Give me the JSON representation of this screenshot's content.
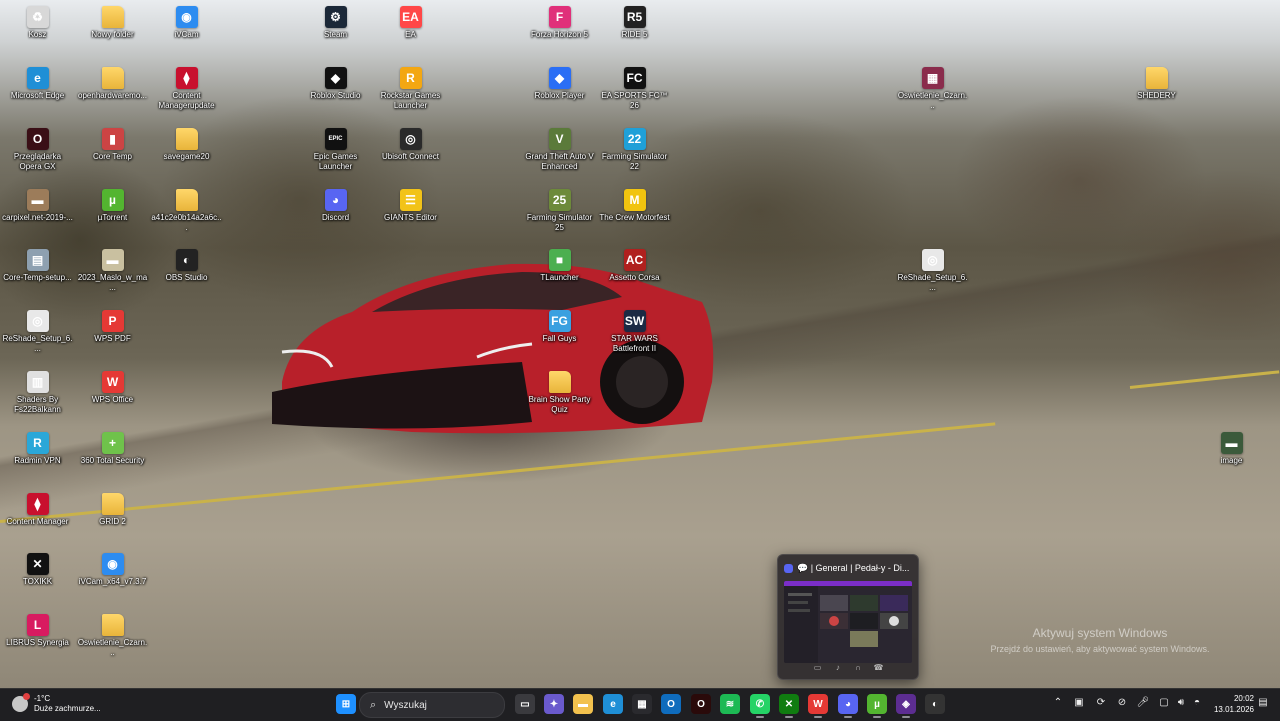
{
  "desktop": {
    "icons": [
      {
        "label": "Kosz",
        "icon": "recycle-bin-icon",
        "color": "#d8d8d8",
        "glyph": "♻"
      },
      {
        "label": "Nowy folder",
        "icon": "folder-icon",
        "color": "folder",
        "glyph": ""
      },
      {
        "label": "iVCam",
        "icon": "ivcam-icon",
        "color": "#2d8cf0",
        "glyph": "◉"
      },
      {
        "label": "Steam",
        "icon": "steam-icon",
        "color": "#1b2838",
        "glyph": "⚙"
      },
      {
        "label": "EA",
        "icon": "ea-icon",
        "color": "#ff4747",
        "glyph": "EA"
      },
      {
        "label": "Forza Horizon 5",
        "icon": "forza-icon",
        "color": "#e0307a",
        "glyph": "F"
      },
      {
        "label": "RIDE 5",
        "icon": "ride5-icon",
        "color": "#222222",
        "glyph": "R5"
      },
      {
        "label": "Microsoft Edge",
        "icon": "edge-icon",
        "color": "#1f8fd6",
        "glyph": "e"
      },
      {
        "label": "openhardwaremo...",
        "icon": "folder-icon",
        "color": "folder",
        "glyph": ""
      },
      {
        "label": "Content Managerupdate",
        "icon": "content-manager-icon",
        "color": "#c8102e",
        "glyph": "⧫"
      },
      {
        "label": "Roblox Studio",
        "icon": "roblox-studio-icon",
        "color": "#111111",
        "glyph": "◆"
      },
      {
        "label": "Rockstar Games Launcher",
        "icon": "rockstar-icon",
        "color": "#f3a712",
        "glyph": "R"
      },
      {
        "label": "Roblox Player",
        "icon": "roblox-player-icon",
        "color": "#2a6ef5",
        "glyph": "◆"
      },
      {
        "label": "EA SPORTS FC™ 26",
        "icon": "ea-fc-icon",
        "color": "#111111",
        "glyph": "FC"
      },
      {
        "label": "Oswietlenie_Czarn...",
        "icon": "winrar-icon",
        "color": "#8a2c4c",
        "glyph": "▦"
      },
      {
        "label": "SHEDERY",
        "icon": "folder-icon",
        "color": "folder",
        "glyph": ""
      },
      {
        "label": "Przeglądarka Opera GX",
        "icon": "opera-gx-icon",
        "color": "#3a0f16",
        "glyph": "O"
      },
      {
        "label": "Core Temp",
        "icon": "core-temp-icon",
        "color": "#c44",
        "glyph": "▮"
      },
      {
        "label": "savegame20",
        "icon": "folder-icon",
        "color": "folder",
        "glyph": ""
      },
      {
        "label": "Epic Games Launcher",
        "icon": "epic-games-icon",
        "color": "#111111",
        "glyph": "EPIC"
      },
      {
        "label": "Ubisoft Connect",
        "icon": "ubisoft-icon",
        "color": "#2a2a2a",
        "glyph": "◎"
      },
      {
        "label": "Grand Theft Auto V Enhanced",
        "icon": "gta5-icon",
        "color": "#5b7a3a",
        "glyph": "V"
      },
      {
        "label": "Farming Simulator 22",
        "icon": "farming-sim-22-icon",
        "color": "#1fa0d8",
        "glyph": "22"
      },
      {
        "label": "carpixel.net-2019-...",
        "icon": "image-file-icon",
        "color": "#9c7c5a",
        "glyph": "▬"
      },
      {
        "label": "µTorrent",
        "icon": "utorrent-icon",
        "color": "#53b530",
        "glyph": "µ"
      },
      {
        "label": "a41c2e0b14a2a6c...",
        "icon": "folder-icon",
        "color": "folder",
        "glyph": ""
      },
      {
        "label": "Discord",
        "icon": "discord-icon",
        "color": "#5865f2",
        "glyph": "◕"
      },
      {
        "label": "GIANTS Editor",
        "icon": "giants-editor-icon",
        "color": "#f2c318",
        "glyph": "☰"
      },
      {
        "label": "Farming Simulator 25",
        "icon": "farming-sim-25-icon",
        "color": "#6d8a3a",
        "glyph": "25"
      },
      {
        "label": "The Crew Motorfest",
        "icon": "crew-motorfest-icon",
        "color": "#f1c40f",
        "glyph": "M"
      },
      {
        "label": "Core-Temp-setup...",
        "icon": "installer-icon",
        "color": "#8ea0b0",
        "glyph": "▤"
      },
      {
        "label": "2023_Maslo_w_ma...",
        "icon": "image-file-icon",
        "color": "#c9c0a0",
        "glyph": "▬"
      },
      {
        "label": "OBS Studio",
        "icon": "obs-icon",
        "color": "#222222",
        "glyph": "◐"
      },
      {
        "label": "TLauncher",
        "icon": "tlauncher-icon",
        "color": "#4caf50",
        "glyph": "■"
      },
      {
        "label": "Assetto Corsa",
        "icon": "assetto-corsa-icon",
        "color": "#b0201e",
        "glyph": "AC"
      },
      {
        "label": "ReShade_Setup_6....",
        "icon": "reshade-icon",
        "color": "#e8e8e8",
        "glyph": "◎"
      },
      {
        "label": "ReShade_Setup_6....",
        "icon": "reshade-icon",
        "color": "#e8e8e8",
        "glyph": "◎"
      },
      {
        "label": "WPS PDF",
        "icon": "wps-pdf-icon",
        "color": "#e53935",
        "glyph": "P"
      },
      {
        "label": "Fall Guys",
        "icon": "fall-guys-icon",
        "color": "#3aa0e0",
        "glyph": "FG"
      },
      {
        "label": "STAR WARS Battlefront II",
        "icon": "battlefront-icon",
        "color": "#1c2a44",
        "glyph": "SW"
      },
      {
        "label": "Shaders By Fs22Balkann",
        "icon": "zip-file-icon",
        "color": "#e0e0e0",
        "glyph": "▥"
      },
      {
        "label": "WPS Office",
        "icon": "wps-office-icon",
        "color": "#e53935",
        "glyph": "W"
      },
      {
        "label": "Brain Show Party Quiz",
        "icon": "folder-icon",
        "color": "folder",
        "glyph": ""
      },
      {
        "label": "Radmin VPN",
        "icon": "radmin-vpn-icon",
        "color": "#2aa7d8",
        "glyph": "R"
      },
      {
        "label": "360 Total Security",
        "icon": "360-security-icon",
        "color": "#6fc24b",
        "glyph": "+"
      },
      {
        "label": "image",
        "icon": "image-file-icon",
        "color": "#3b5a3b",
        "glyph": "▬"
      },
      {
        "label": "Content Manager",
        "icon": "content-manager-icon",
        "color": "#c8102e",
        "glyph": "⧫"
      },
      {
        "label": "GRID 2",
        "icon": "folder-icon",
        "color": "folder",
        "glyph": ""
      },
      {
        "label": "TOXIKK",
        "icon": "toxikk-icon",
        "color": "#111111",
        "glyph": "✕"
      },
      {
        "label": "iVCam_x64_v7.3.7",
        "icon": "ivcam-icon",
        "color": "#2d8cf0",
        "glyph": "◉"
      },
      {
        "label": "LIBRUS Synergia",
        "icon": "librus-icon",
        "color": "#d81b60",
        "glyph": "L"
      },
      {
        "label": "Oswietlenie_Czarn...",
        "icon": "folder-icon",
        "color": "folder",
        "glyph": ""
      }
    ]
  },
  "activation": {
    "title": "Aktywuj system Windows",
    "subtitle": "Przejdź do ustawień, aby aktywować system Windows."
  },
  "preview": {
    "title": "💬 | General | Pedał-y - Di...",
    "icon": "discord-icon"
  },
  "taskbar": {
    "weather": {
      "temp": "-1°C",
      "condition": "Duże zachmurze..."
    },
    "search_placeholder": "Wyszukaj",
    "clock": {
      "time": "20:02",
      "date": "13.01.2026"
    },
    "apps": [
      {
        "icon": "start-icon",
        "color": "#1e90ff",
        "glyph": "⊞"
      },
      {
        "icon": "task-view-icon",
        "color": "#3a3a3e",
        "glyph": "▭"
      },
      {
        "icon": "copilot-icon",
        "color": "#6a5acd",
        "glyph": "✦"
      },
      {
        "icon": "file-explorer-icon",
        "color": "#f2c14e",
        "glyph": "▬"
      },
      {
        "icon": "edge-icon",
        "color": "#1f8fd6",
        "glyph": "e"
      },
      {
        "icon": "store-icon",
        "color": "#2a2a2e",
        "glyph": "▦"
      },
      {
        "icon": "outlook-icon",
        "color": "#0f6cbd",
        "glyph": "O"
      },
      {
        "icon": "opera-icon",
        "color": "#2a0a0a",
        "glyph": "O"
      },
      {
        "icon": "spotify-icon",
        "color": "#1db954",
        "glyph": "≋"
      },
      {
        "icon": "whatsapp-icon",
        "color": "#25d366",
        "glyph": "✆"
      },
      {
        "icon": "xbox-icon",
        "color": "#107c10",
        "glyph": "✕"
      },
      {
        "icon": "wps-office-icon",
        "color": "#e53935",
        "glyph": "W"
      },
      {
        "icon": "discord-icon",
        "color": "#5865f2",
        "glyph": "◕"
      },
      {
        "icon": "utorrent-icon",
        "color": "#53b530",
        "glyph": "µ"
      },
      {
        "icon": "visual-studio-icon",
        "color": "#5c2d91",
        "glyph": "◈"
      },
      {
        "icon": "obs-icon",
        "color": "#333",
        "glyph": "◐"
      }
    ]
  }
}
